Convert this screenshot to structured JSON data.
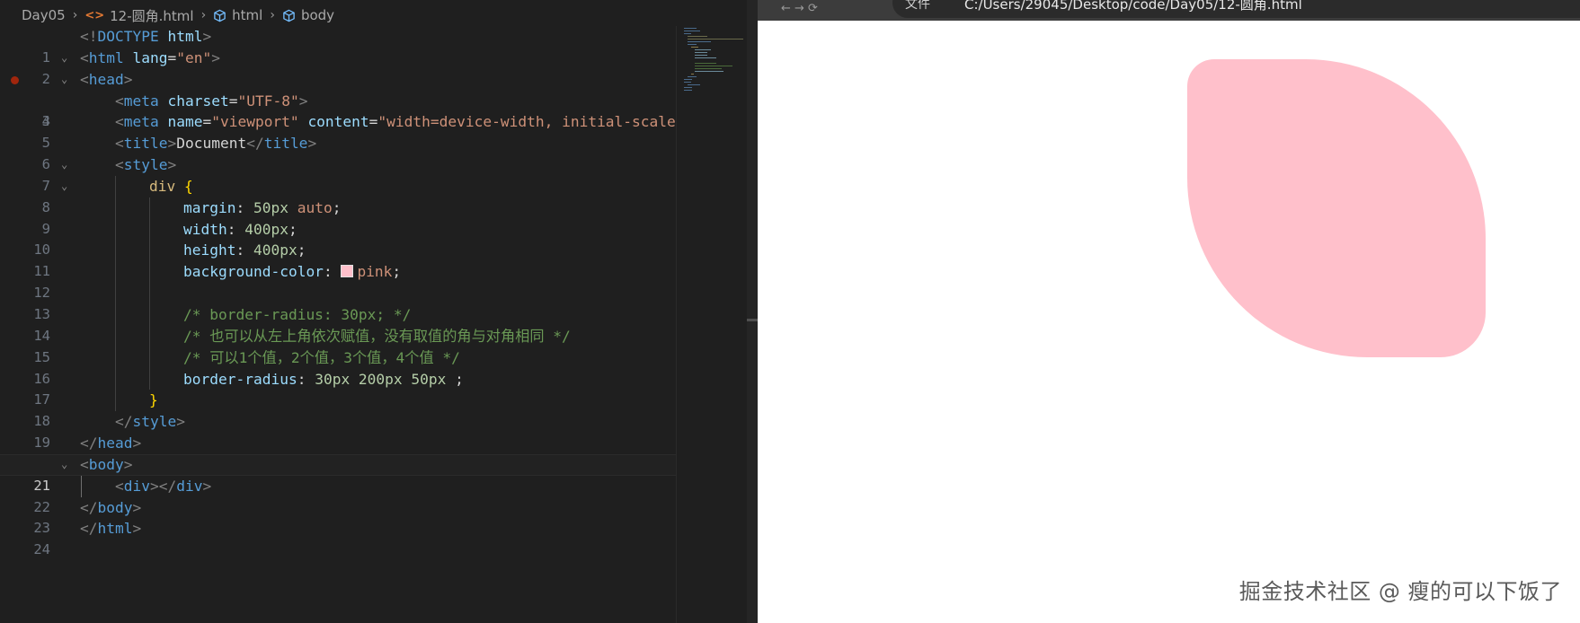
{
  "editor": {
    "breadcrumb": {
      "folder": "Day05",
      "file": "12-圆角.html",
      "element1": "html",
      "element2": "body"
    },
    "current_line": 21,
    "breakpoint_line": 3
  },
  "code": {
    "l1": {
      "num": "1",
      "p1": "<!",
      "kw": "DOCTYPE",
      "sp": " ",
      "a": "html",
      "p2": ">"
    },
    "l2": {
      "num": "2",
      "p1": "<",
      "t": "html",
      "sp": " ",
      "a": "lang",
      "eq": "=",
      "s": "\"en\"",
      "p2": ">"
    },
    "l3": {
      "num": "3",
      "p1": "<",
      "t": "head",
      "p2": ">"
    },
    "l4": {
      "num": "4",
      "p1": "<",
      "t": "meta",
      "sp": " ",
      "a": "charset",
      "eq": "=",
      "s": "\"UTF-8\"",
      "p2": ">"
    },
    "l5": {
      "num": "5",
      "p1": "<",
      "t": "meta",
      "sp": " ",
      "a": "name",
      "eq": "=",
      "s": "\"viewport\"",
      "sp2": " ",
      "a2": "content",
      "eq2": "=",
      "s2": "\"width=device-width, initial-scale="
    },
    "l6": {
      "num": "6",
      "p1": "<",
      "t": "title",
      "p2": ">",
      "txt": "Document",
      "p3": "</",
      "t2": "title",
      "p4": ">"
    },
    "l7": {
      "num": "7",
      "p1": "<",
      "t": "style",
      "p2": ">"
    },
    "l8": {
      "num": "8",
      "sel": "div",
      "sp": " ",
      "br": "{"
    },
    "l9": {
      "num": "9",
      "prop": "margin",
      "col": ": ",
      "n": "50px",
      "sp": " ",
      "v": "auto",
      "semi": ";"
    },
    "l10": {
      "num": "10",
      "prop": "width",
      "col": ": ",
      "n": "400px",
      "semi": ";"
    },
    "l11": {
      "num": "11",
      "prop": "height",
      "col": ": ",
      "n": "400px",
      "semi": ";"
    },
    "l12": {
      "num": "12",
      "prop": "background-color",
      "col": ": ",
      "v": "pink",
      "semi": ";"
    },
    "l13": {
      "num": "13"
    },
    "l14": {
      "num": "14",
      "cmt": "/* border-radius: 30px; */"
    },
    "l15": {
      "num": "15",
      "cmt": "/* 也可以从左上角依次赋值，没有取值的角与对角相同 */"
    },
    "l16": {
      "num": "16",
      "cmt": "/* 可以1个值，2个值，3个值，4个值 */"
    },
    "l17": {
      "num": "17",
      "prop": "border-radius",
      "col": ": ",
      "n": "30px 200px 50px",
      "tail": " ;"
    },
    "l18": {
      "num": "18",
      "br": "}"
    },
    "l19": {
      "num": "19",
      "p1": "</",
      "t": "style",
      "p2": ">"
    },
    "l20": {
      "num": "20",
      "p1": "</",
      "t": "head",
      "p2": ">"
    },
    "l21": {
      "num": "21",
      "p1": "<",
      "t": "body",
      "p2": ">"
    },
    "l22": {
      "num": "22",
      "p1": "<",
      "t": "div",
      "p2": "></",
      "t2": "div",
      "p3": ">"
    },
    "l23": {
      "num": "23",
      "p1": "</",
      "t": "body",
      "p2": ">"
    },
    "l24": {
      "num": "24",
      "p1": "</",
      "t": "html",
      "p2": ">"
    }
  },
  "browser": {
    "security_label": "文件",
    "url": "C:/Users/29045/Desktop/code/Day05/12-圆角.html",
    "watermark": "掘金技术社区 @ 瘦的可以下饭了"
  },
  "colors": {
    "editor_bg": "#1f1f1f",
    "tag": "#569cd6",
    "attribute": "#9cdcfe",
    "string": "#ce9178",
    "comment": "#6a9955",
    "number": "#b5cea8",
    "selector": "#d7ba7d",
    "pink": "#ffc0cb"
  }
}
